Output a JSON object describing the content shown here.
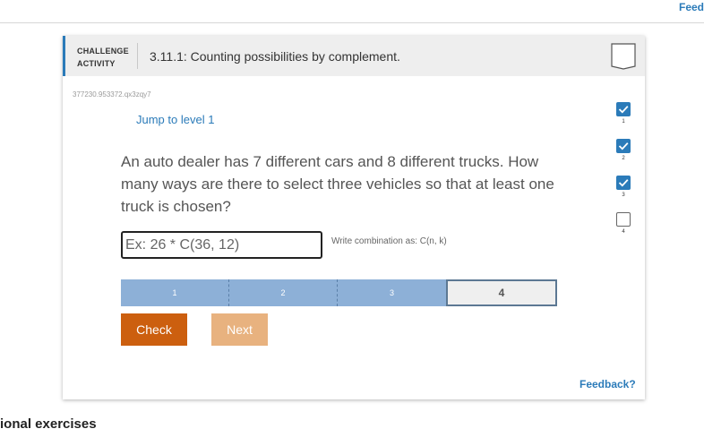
{
  "topbar": {
    "feed_label": "Feed"
  },
  "activity": {
    "type_line1": "CHALLENGE",
    "type_line2": "ACTIVITY",
    "title": "3.11.1: Counting possibilities by complement.",
    "id": "377230.953372.qx3zqy7",
    "jump_label": "Jump to level 1",
    "question": "An auto dealer has 7 different cars and 8 different trucks. How many ways are there to select three vehicles so that at least one truck is chosen?",
    "input": {
      "value": "",
      "placeholder": "Ex: 26 * C(36, 12)"
    },
    "hint": "Write combination as: C(n, k)",
    "progress": {
      "segments": [
        "1",
        "2",
        "3",
        "4"
      ],
      "current_level": 4,
      "completed": [
        1,
        2,
        3
      ]
    },
    "check_label": "Check",
    "next_label": "Next",
    "feedback_label": "Feedback?",
    "levels": [
      {
        "number": "1",
        "completed": true
      },
      {
        "number": "2",
        "completed": true
      },
      {
        "number": "3",
        "completed": true
      },
      {
        "number": "4",
        "completed": false
      }
    ]
  },
  "section_heading": "ional exercises",
  "colors": {
    "accent": "#2b7bb9",
    "check_button": "#cc5f0f",
    "next_button": "#e8b27f",
    "progress_done": "#8db0d7"
  }
}
